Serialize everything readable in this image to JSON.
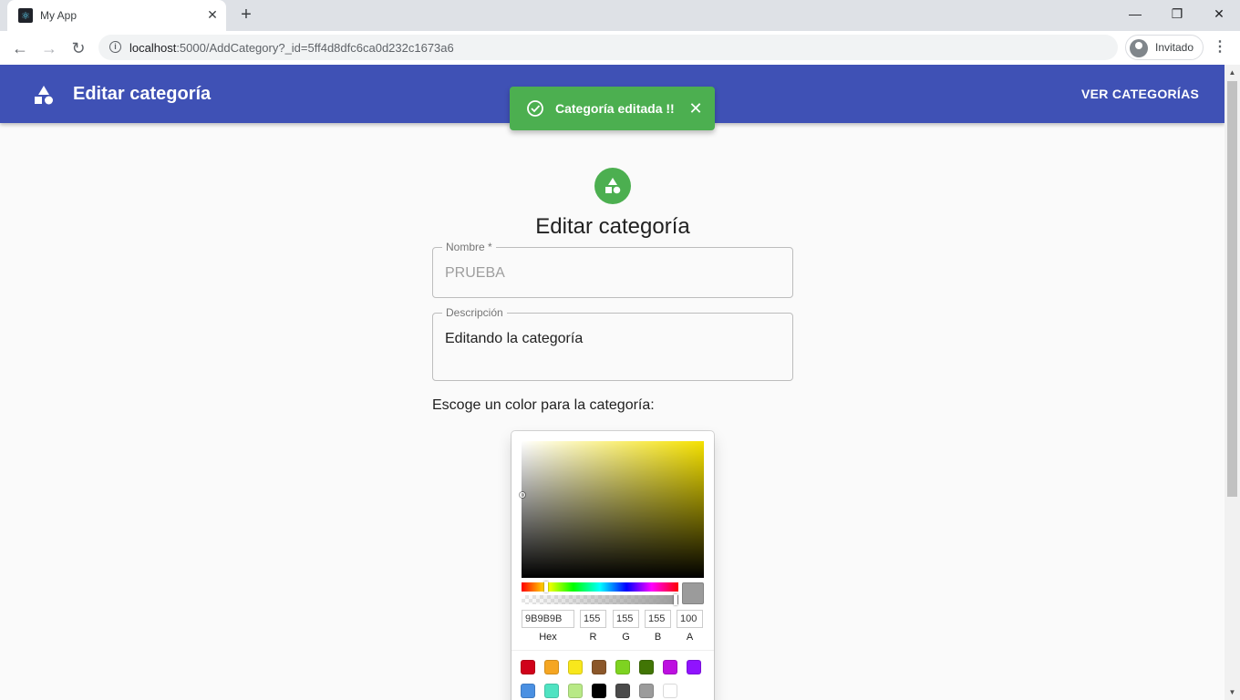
{
  "browser": {
    "tab_title": "My App",
    "url_host": "localhost",
    "url_rest": ":5000/AddCategory?_id=5ff4d8dfc6ca0d232c1673a6",
    "profile_label": "Invitado"
  },
  "appbar": {
    "title": "Editar categoría",
    "link": "VER CATEGORÍAS"
  },
  "snackbar": {
    "message": "Categoría editada !!",
    "color": "#4caf50"
  },
  "form": {
    "title": "Editar categoría",
    "nombre_label": "Nombre *",
    "nombre_value": "PRUEBA",
    "descripcion_label": "Descripción",
    "descripcion_value": "Editando la categoría",
    "color_prompt": "Escoge un color para la categoría:"
  },
  "picker": {
    "hex": "9B9B9B",
    "r": "155",
    "g": "155",
    "b": "155",
    "a": "100",
    "hex_label": "Hex",
    "r_label": "R",
    "g_label": "G",
    "b_label": "B",
    "a_label": "A",
    "preset_colors": [
      "#d0021b",
      "#f5a623",
      "#f8e71c",
      "#8b572a",
      "#7ed321",
      "#417505",
      "#bd10e0",
      "#9013fe",
      "#4a90e2",
      "#50e3c2",
      "#b8e986",
      "#000000",
      "#4a4a4a",
      "#9b9b9b",
      "#ffffff"
    ]
  },
  "colors": {
    "primary": "#3f51b5",
    "success": "#4caf50"
  }
}
